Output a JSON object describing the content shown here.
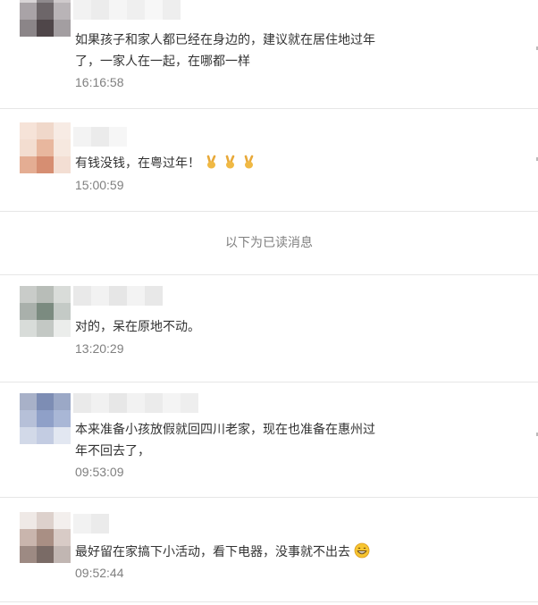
{
  "messages": [
    {
      "text": "如果孩子和家人都已经在身边的，建议就在居住地过年了，一家人在一起，在哪都一样",
      "time": "16:16:58"
    },
    {
      "text": "有钱没钱，在粤过年！",
      "time": "15:00:59",
      "emoji": "victory-hand x3"
    },
    {
      "text": "对的，呆在原地不动。",
      "time": "13:20:29"
    },
    {
      "text": "本来准备小孩放假就回四川老家，现在也准备在惠州过年不回去了，",
      "time": "09:53:09"
    },
    {
      "text": "最好留在家搞下小活动，看下电器，没事就不出去",
      "time": "09:52:44",
      "emoji": "grinning-face"
    }
  ],
  "divider": {
    "label": "以下为已读消息"
  }
}
